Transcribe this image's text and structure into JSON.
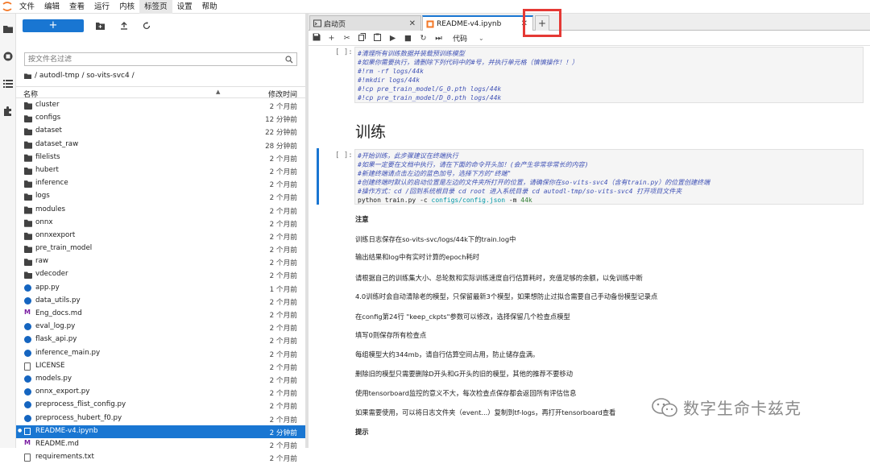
{
  "menubar": {
    "items": [
      "文件",
      "编辑",
      "查看",
      "运行",
      "内核",
      "标签页",
      "设置",
      "帮助"
    ],
    "active_index": 5
  },
  "filebrowser": {
    "new_button": "+",
    "filter_placeholder": "按文件名过滤",
    "breadcrumb": "/ autodl-tmp / so-vits-svc4 /",
    "col_name": "名称",
    "col_modified": "修改时间",
    "files": [
      {
        "name": "cluster",
        "type": "folder",
        "modified": "2 个月前"
      },
      {
        "name": "configs",
        "type": "folder",
        "modified": "12 分钟前"
      },
      {
        "name": "dataset",
        "type": "folder",
        "modified": "22 分钟前"
      },
      {
        "name": "dataset_raw",
        "type": "folder",
        "modified": "28 分钟前"
      },
      {
        "name": "filelists",
        "type": "folder",
        "modified": "2 个月前"
      },
      {
        "name": "hubert",
        "type": "folder",
        "modified": "2 个月前"
      },
      {
        "name": "inference",
        "type": "folder",
        "modified": "2 个月前"
      },
      {
        "name": "logs",
        "type": "folder",
        "modified": "2 个月前"
      },
      {
        "name": "modules",
        "type": "folder",
        "modified": "2 个月前"
      },
      {
        "name": "onnx",
        "type": "folder",
        "modified": "2 个月前"
      },
      {
        "name": "onnxexport",
        "type": "folder",
        "modified": "2 个月前"
      },
      {
        "name": "pre_train_model",
        "type": "folder",
        "modified": "2 个月前"
      },
      {
        "name": "raw",
        "type": "folder",
        "modified": "2 个月前"
      },
      {
        "name": "vdecoder",
        "type": "folder",
        "modified": "2 个月前"
      },
      {
        "name": "app.py",
        "type": "py",
        "modified": "1 个月前"
      },
      {
        "name": "data_utils.py",
        "type": "py",
        "modified": "2 个月前"
      },
      {
        "name": "Eng_docs.md",
        "type": "md",
        "modified": "2 个月前"
      },
      {
        "name": "eval_log.py",
        "type": "py",
        "modified": "2 个月前"
      },
      {
        "name": "flask_api.py",
        "type": "py",
        "modified": "2 个月前"
      },
      {
        "name": "inference_main.py",
        "type": "py",
        "modified": "2 个月前"
      },
      {
        "name": "LICENSE",
        "type": "txt",
        "modified": "2 个月前"
      },
      {
        "name": "models.py",
        "type": "py",
        "modified": "2 个月前"
      },
      {
        "name": "onnx_export.py",
        "type": "py",
        "modified": "2 个月前"
      },
      {
        "name": "preprocess_flist_config.py",
        "type": "py",
        "modified": "2 个月前"
      },
      {
        "name": "preprocess_hubert_f0.py",
        "type": "py",
        "modified": "2 个月前"
      },
      {
        "name": "README-v4.ipynb",
        "type": "nb",
        "modified": "2 分钟前",
        "selected": true
      },
      {
        "name": "README.md",
        "type": "md",
        "modified": "2 个月前"
      },
      {
        "name": "requirements.txt",
        "type": "txt",
        "modified": "2 个月前"
      }
    ]
  },
  "tabs": [
    {
      "label": "启动页",
      "icon": "launcher-icon"
    },
    {
      "label": "README-v4.ipynb",
      "icon": "notebook-icon",
      "current": true
    }
  ],
  "notebook_toolbar": {
    "cell_type": "代码"
  },
  "cells": {
    "cell1": {
      "prompt": "[ ]:",
      "lines": [
        "#清理所有训练数据并装载预训练模型",
        "#如果你需要执行，请删除下列代码中的#号，并执行单元格（慎慎操作！！）",
        "#!rm -rf logs/44k",
        "#!mkdir logs/44k",
        "#!cp pre_train_model/G_0.pth logs/44k",
        "#!cp pre_train_model/D_0.pth logs/44k"
      ]
    },
    "heading": "训练",
    "cell2": {
      "prompt": "[ ]:",
      "lines": [
        "#开始训练，此步骤建议在终端执行",
        "#如果一定要在文档中执行，请在下面的命令开头加！(会产生非常非常长的内容)",
        "#新建终端请点击左边的蓝色加号，选择下方的\"终端\"",
        "#创建终端时默认的启动位置是左边的文件夹所打开的位置，请确保你在so-vits-svc4（含有train.py）的位置创建终端",
        "#操作方式：cd /回到系统根目录    cd root 进入系统目录    cd autodl-tmp/so-vits-svc4 打开项目文件夹"
      ],
      "cmd_prefix": "python train.py -c ",
      "cmd_path": "configs/config.json",
      "cmd_mid": " -m ",
      "cmd_arg": "44k"
    },
    "markdown": [
      {
        "text": "注意",
        "bold": true
      },
      {
        "text": "训练日志保存在so-vits-svc/logs/44k下的train.log中"
      },
      {
        "text": "输出结果和log中有实时计算的epoch耗时"
      },
      {
        "text": "请根据自己的训练集大小、总轮数和实际训练速度自行估算耗时，充值足够的余额，以免训练中断"
      },
      {
        "text": "4.0训练时会自动清除老的模型，只保留最新3个模型，如果想防止过拟合需要自己手动备份模型记录点"
      },
      {
        "text": "在config第24行 \"keep_ckpts\"参数可以修改，选择保留几个检查点模型"
      },
      {
        "text": "填写0则保存所有检查点"
      },
      {
        "text": "每组模型大约344mb，请自行估算空间占用，防止储存盘满。"
      },
      {
        "text": "删除旧的模型只需要删除D开头和G开头的旧的模型，其他的推荐不要移动"
      },
      {
        "text": "使用tensorboard监控的意义不大，每次检查点保存都会返回所有评估信息"
      },
      {
        "text": "如果需要使用，可以将日志文件夹（event...）复制到tf-logs，再打开tensorboard查看"
      },
      {
        "text": "提示",
        "bold": true
      }
    ]
  },
  "watermark": "数字生命卡兹克",
  "colors": {
    "accent": "#1976d2",
    "highlight": "#e53935"
  }
}
